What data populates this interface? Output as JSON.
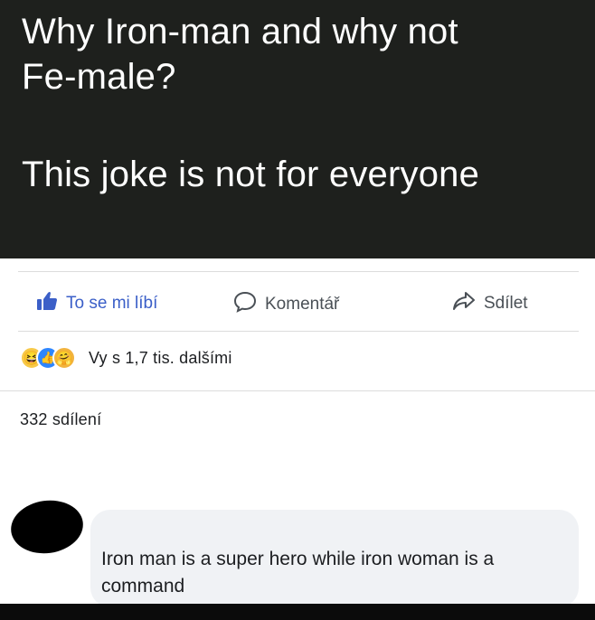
{
  "caption": {
    "line1": "Why Iron-man and why not",
    "line2": "Fe-male?",
    "line3": "This joke is not for everyone"
  },
  "actions": {
    "like_label": "To se mi líbí",
    "comment_label": "Komentář",
    "share_label": "Sdílet"
  },
  "reactions": {
    "icons": [
      "haha-icon",
      "like-icon",
      "care-icon"
    ],
    "summary": "Vy s 1,7 tis. dalšími"
  },
  "shares": {
    "count_text": "332 sdílení"
  },
  "comment": {
    "text": "Iron man is a super hero while iron woman is a command"
  },
  "colors": {
    "banner_bg": "#1e201d",
    "like_blue": "#3b5fc8",
    "bubble_bg": "#f0f2f5"
  }
}
